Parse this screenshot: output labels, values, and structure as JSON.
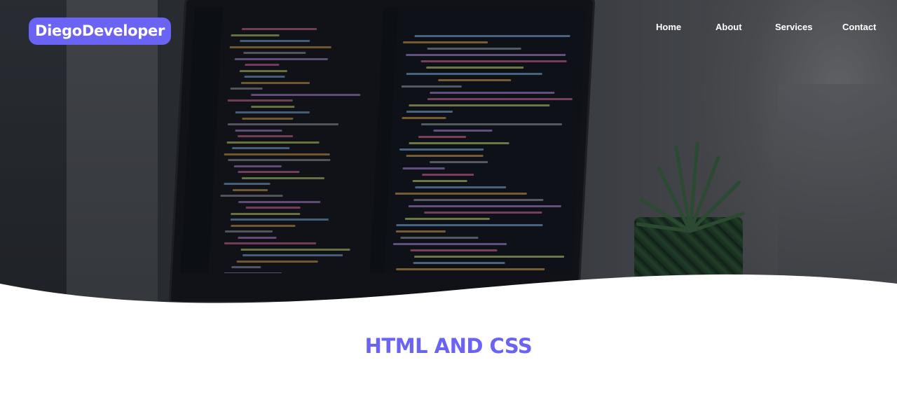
{
  "header": {
    "logo": "DiegoDeveloper",
    "nav": [
      {
        "label": "Home"
      },
      {
        "label": "About"
      },
      {
        "label": "Services"
      },
      {
        "label": "Contact"
      }
    ]
  },
  "hero": {
    "image_description_icon": "laptop-code-photo"
  },
  "main": {
    "section_title": "HTML AND CSS"
  },
  "colors": {
    "accent": "#6a63f3",
    "nav_text": "#ffffff",
    "background": "#ffffff"
  }
}
